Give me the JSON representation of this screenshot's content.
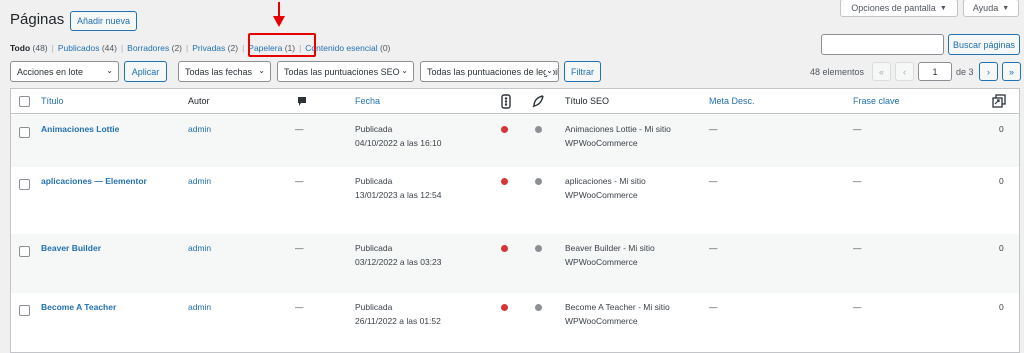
{
  "header": {
    "title": "Páginas",
    "add_new": "Añadir nueva",
    "screen_options": "Opciones de pantalla",
    "help": "Ayuda",
    "search_button": "Buscar páginas",
    "search_value": ""
  },
  "filters": {
    "all": {
      "label": "Todo",
      "count": "(48)"
    },
    "published": {
      "label": "Publicados",
      "count": "(44)"
    },
    "drafts": {
      "label": "Borradores",
      "count": "(2)"
    },
    "private": {
      "label": "Privadas",
      "count": "(2)"
    },
    "trash": {
      "label": "Papelera",
      "count": "(1)"
    },
    "essential": {
      "label": "Contenido esencial",
      "count": "(0)"
    }
  },
  "toolbar": {
    "bulk_actions": "Acciones en lote",
    "apply": "Aplicar",
    "dates": "Todas las fechas",
    "seo_scores": "Todas las puntuaciones SEO",
    "readability_scores": "Todas las puntuaciones de legibilidad",
    "filter": "Filtrar",
    "items_count": "48 elementos",
    "first": "«",
    "prev": "‹",
    "page": "1",
    "of_pages": "de 3",
    "next": "›",
    "last": "»"
  },
  "columns": {
    "title": "Título",
    "author": "Autor",
    "date": "Fecha",
    "seo_title": "Título SEO",
    "meta_desc": "Meta Desc.",
    "keyphrase": "Frase clave"
  },
  "rows": [
    {
      "title": "Animaciones Lottie",
      "author": "admin",
      "comments": "—",
      "status": "Publicada",
      "date": "04/10/2022 a las 16:10",
      "seo_1": "Animaciones Lottie - Mi sitio",
      "seo_2": "WPWooCommerce",
      "meta": "—",
      "key": "—",
      "links": "0"
    },
    {
      "title": "aplicaciones — Elementor",
      "author": "admin",
      "comments": "—",
      "status": "Publicada",
      "date": "13/01/2023 a las 12:54",
      "seo_1": "aplicaciones - Mi sitio",
      "seo_2": "WPWooCommerce",
      "meta": "—",
      "key": "—",
      "links": "0"
    },
    {
      "title": "Beaver Builder",
      "author": "admin",
      "comments": "—",
      "status": "Publicada",
      "date": "03/12/2022 a las 03:23",
      "seo_1": "Beaver Builder - Mi sitio",
      "seo_2": "WPWooCommerce",
      "meta": "—",
      "key": "—",
      "links": "0"
    },
    {
      "title": "Become A Teacher",
      "author": "admin",
      "comments": "—",
      "status": "Publicada",
      "date": "26/11/2022 a las 01:52",
      "seo_1": "Become A Teacher - Mi sitio",
      "seo_2": "WPWooCommerce",
      "meta": "—",
      "key": "—",
      "links": "0"
    }
  ],
  "colors": {
    "accent": "#2271b1",
    "seo_red": "#d63638",
    "readability_gray": "#8c8f94",
    "highlight": "#e60000"
  }
}
